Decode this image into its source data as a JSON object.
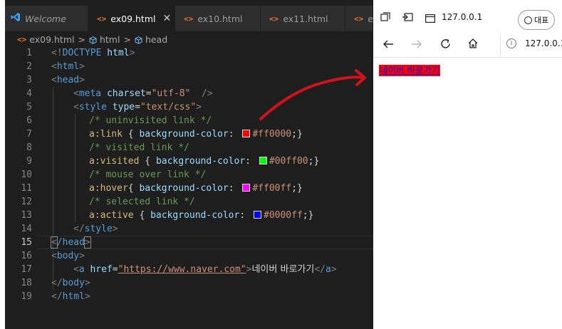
{
  "editor": {
    "tabs": [
      {
        "label": "Welcome",
        "icon": "vscode-icon",
        "active": false
      },
      {
        "label": "ex09.html",
        "icon": "html-file-icon",
        "active": true
      },
      {
        "label": "ex10.html",
        "icon": "html-file-icon",
        "active": false
      },
      {
        "label": "ex11.html",
        "icon": "html-file-icon",
        "active": false
      },
      {
        "label": "ex",
        "icon": "html-file-icon",
        "active": false
      }
    ],
    "close_glyph": "✕",
    "breadcrumb": [
      "ex09.html",
      "html",
      "head"
    ],
    "line_numbers": [
      "1",
      "2",
      "3",
      "4",
      "5",
      "6",
      "7",
      "8",
      "9",
      "10",
      "11",
      "12",
      "13",
      "14",
      "15",
      "16",
      "17",
      "18",
      "19"
    ],
    "code": {
      "l1": {
        "a": "<!",
        "b": "DOCTYPE",
        "c": " html",
        "d": ">"
      },
      "l2": {
        "a": "<",
        "b": "html",
        "c": ">"
      },
      "l3": {
        "a": "<",
        "b": "head",
        "c": ">"
      },
      "l4": {
        "a": "<",
        "b": "meta",
        "c": " charset",
        "d": "=",
        "e": "\"utf-8\"",
        "f": "  />"
      },
      "l5": {
        "a": "<",
        "b": "style",
        "c": " type",
        "d": "=",
        "e": "\"text/css\"",
        "f": ">"
      },
      "l6": "/* uninvisited link */",
      "l7": {
        "sel": "a:link",
        "p1": " { ",
        "prop": "background-color",
        "p2": ": ",
        "val": "#ff0000",
        "p3": ";}"
      },
      "l8": "/* visited link */",
      "l9": {
        "sel": "a:visited",
        "p1": " { ",
        "prop": "background-color",
        "p2": ": ",
        "val": "#00ff00",
        "p3": ";}"
      },
      "l10": "/* mouse over link */",
      "l11": {
        "sel": "a:hover",
        "p1": "{ ",
        "prop": "background-color",
        "p2": ": ",
        "val": "#ff00ff",
        "p3": ";}"
      },
      "l12": "/* selected link */",
      "l13": {
        "sel": "a:active",
        "p1": " { ",
        "prop": "background-color",
        "p2": ": ",
        "val": "#0000ff",
        "p3": ";}"
      },
      "l14": {
        "a": "</",
        "b": "style",
        "c": ">"
      },
      "l15": {
        "a": "<",
        "b": "/head",
        "c": ">"
      },
      "l16": {
        "a": "<",
        "b": "body",
        "c": ">"
      },
      "l17": {
        "a": "<",
        "b": "a",
        "c": " href",
        "d": "=",
        "e": "\"https://www.naver.com\"",
        "f": ">",
        "g": "네이버 바로가기",
        "h": "</",
        "i": "a",
        "j": ">"
      },
      "l18": {
        "a": "</",
        "b": "body",
        "c": ">"
      },
      "l19": {
        "a": "</",
        "b": "html",
        "c": ">"
      }
    },
    "swatch_colors": {
      "link": "#ff0000",
      "visited": "#00ff00",
      "hover": "#ff00ff",
      "active": "#0000ff"
    }
  },
  "browser": {
    "tab_title": "127.0.0.1",
    "pill_label": "대표",
    "address": "127.0.0.1",
    "page_link_text": "네이버 바로가기",
    "link_bg_color": "#ff0000"
  },
  "annotation_color": "#d0121b"
}
